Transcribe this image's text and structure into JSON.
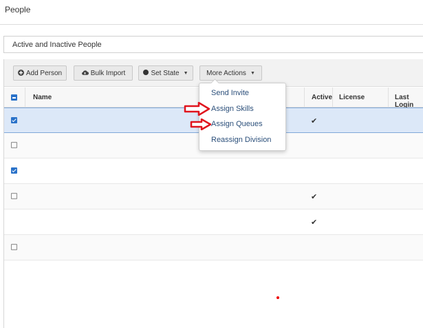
{
  "page": {
    "title": "People"
  },
  "filter": {
    "label": "Active and Inactive People"
  },
  "toolbar": {
    "add_person": "Add Person",
    "bulk_import": "Bulk Import",
    "set_state": "Set State",
    "more_actions": "More Actions"
  },
  "table": {
    "columns": [
      "Name",
      "Active",
      "License",
      "Last Login"
    ],
    "rows": [
      {
        "checked": true,
        "active": true,
        "selected": true
      },
      {
        "checked": false,
        "active": false
      },
      {
        "checked": true,
        "active": false
      },
      {
        "checked": false,
        "active": true
      },
      {
        "checked": false,
        "active": true
      },
      {
        "checked": false,
        "active": false
      }
    ]
  },
  "menu": {
    "items": [
      "Send Invite",
      "Assign Skills",
      "Assign Queues",
      "Reassign Division"
    ]
  },
  "icons": {
    "add_person": "plus-circle-icon",
    "bulk_import": "cloud-upload-icon",
    "set_state": "status-dot-icon",
    "caret": "caret-down-icon",
    "active_check": "check-icon"
  },
  "colors": {
    "accent": "#2a72c9",
    "menu_text": "#2b4f7a",
    "annotation": "#e0141e"
  }
}
